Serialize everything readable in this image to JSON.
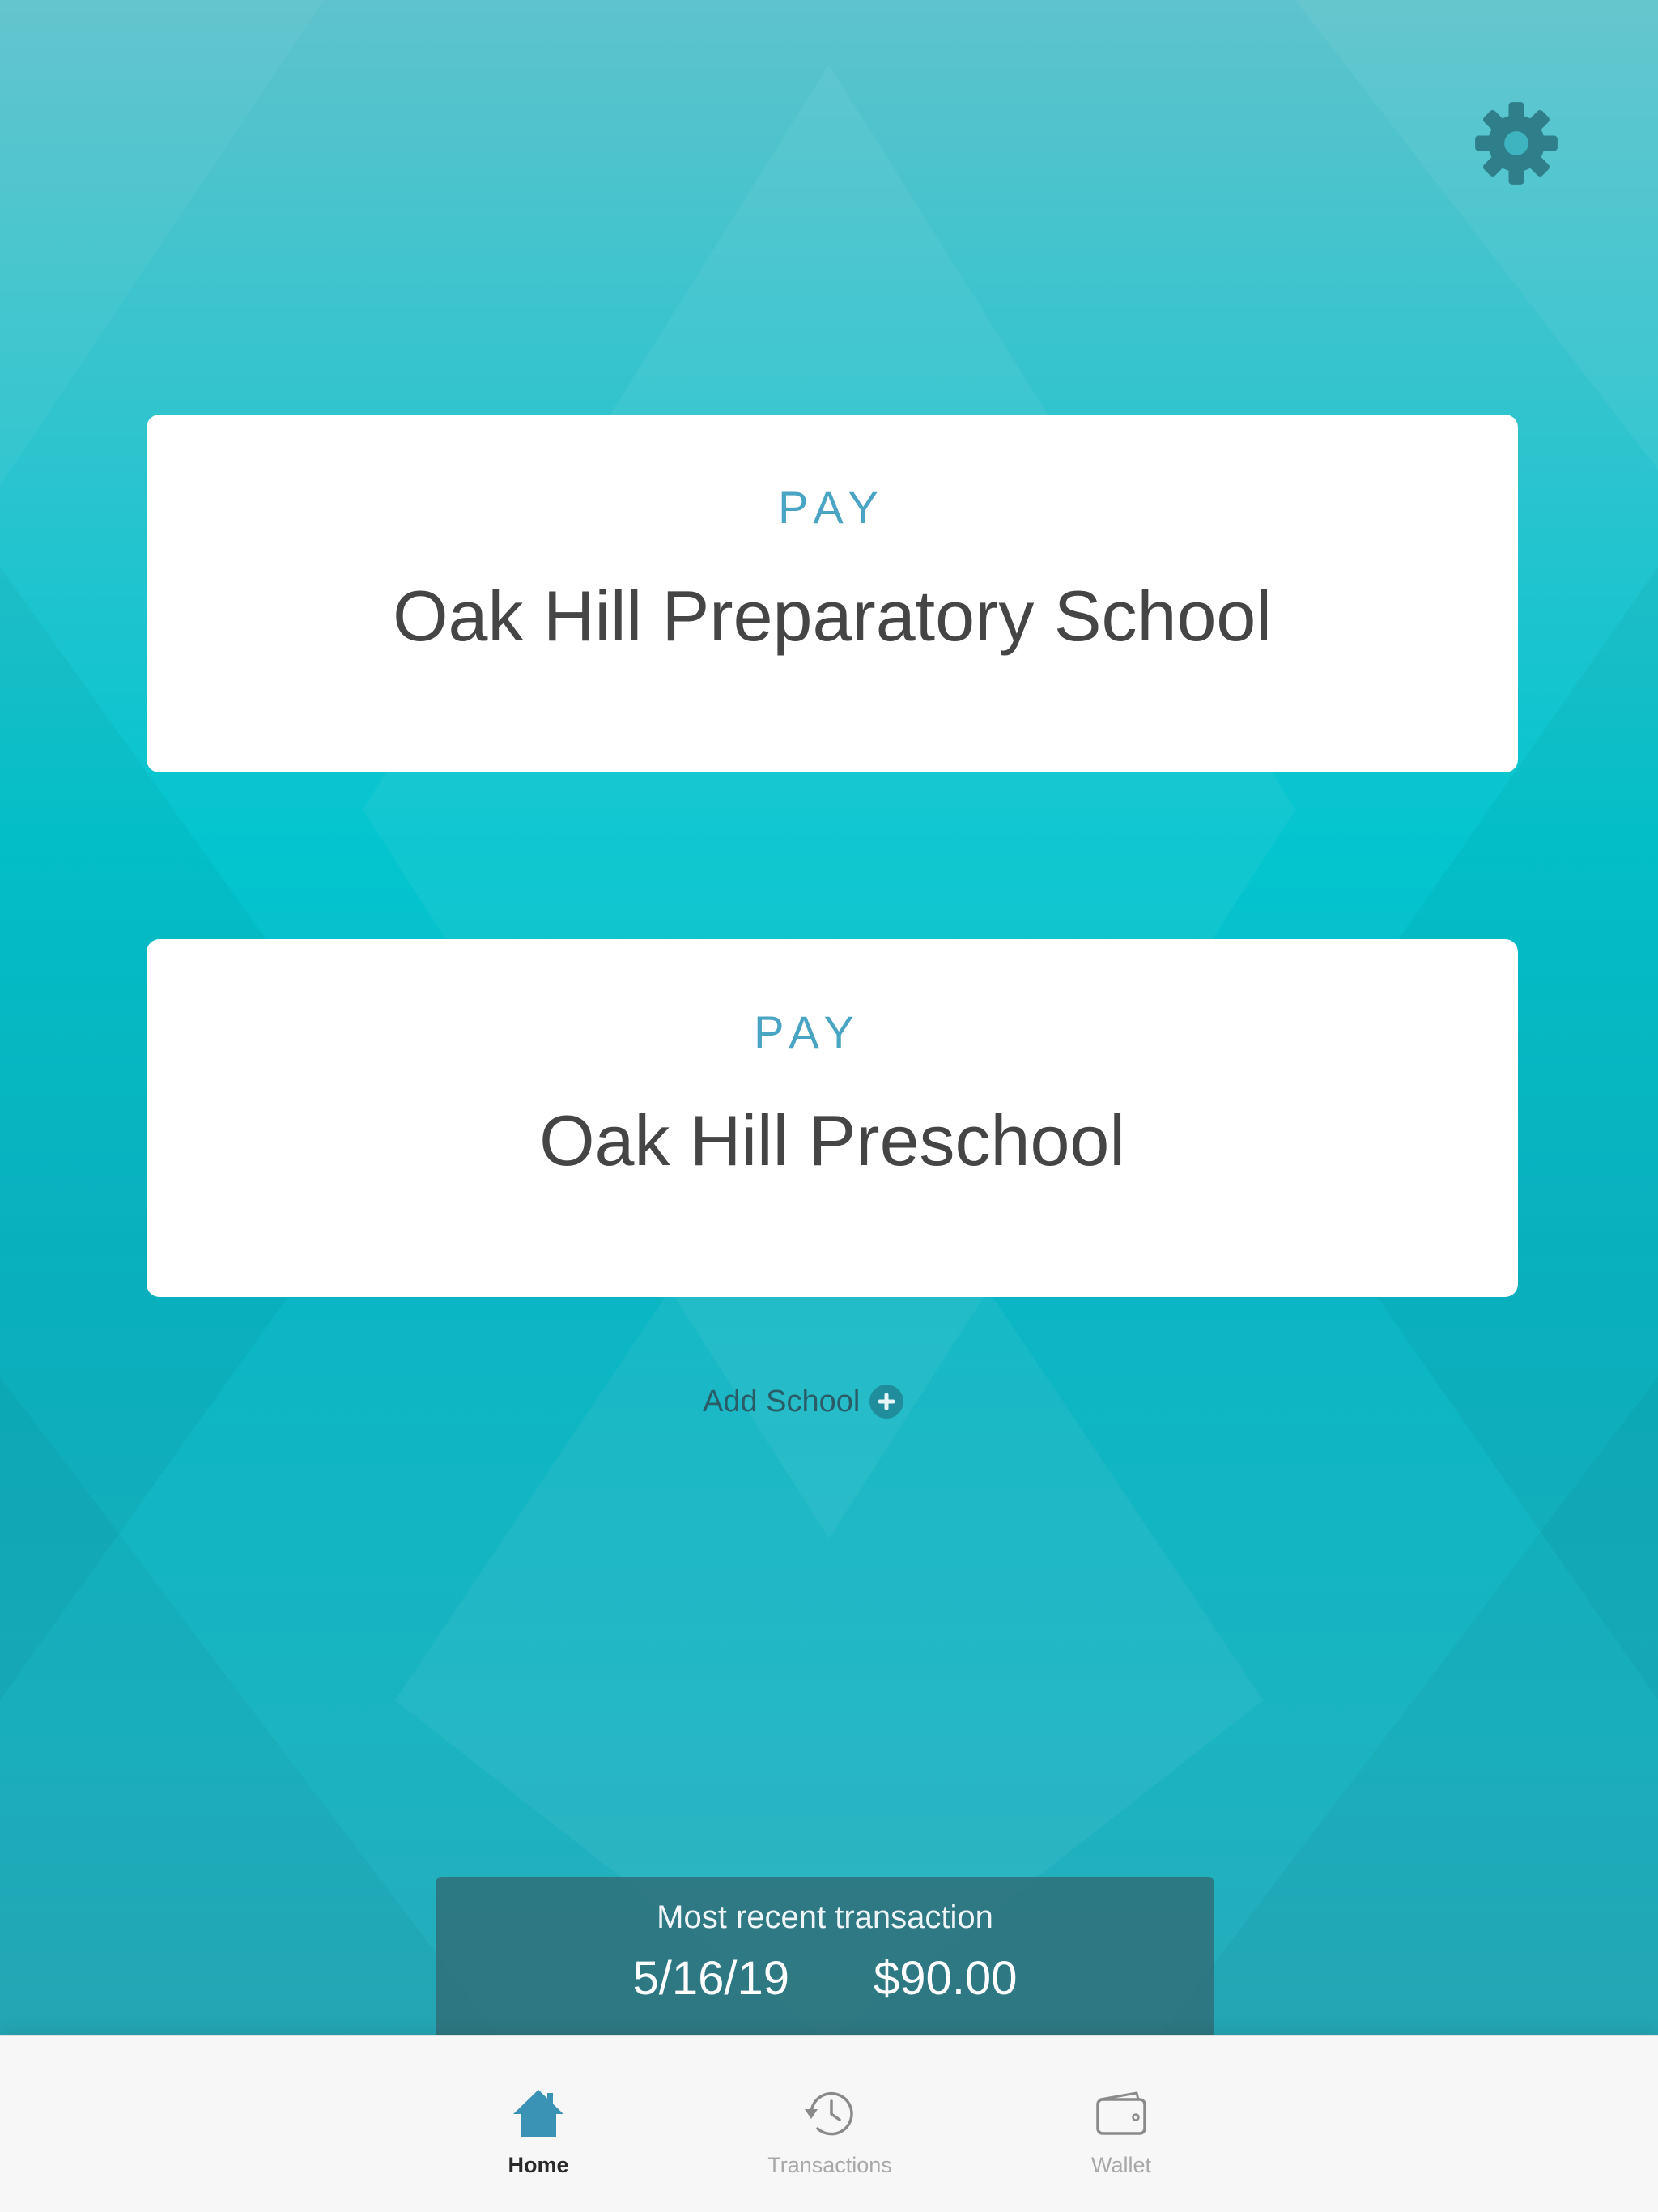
{
  "settings": {
    "icon": "gear-icon"
  },
  "schools": [
    {
      "action_label": "PAY",
      "name": "Oak Hill Preparatory School"
    },
    {
      "action_label": "PAY",
      "name": "Oak Hill Preschool"
    }
  ],
  "add_school": {
    "label": "Add School",
    "icon": "plus-circle-icon"
  },
  "recent_transaction": {
    "title": "Most recent transaction",
    "date": "5/16/19",
    "amount": "$90.00"
  },
  "tabbar": {
    "tabs": [
      {
        "label": "Home",
        "icon": "home-icon",
        "active": true
      },
      {
        "label": "Transactions",
        "icon": "history-icon",
        "active": false
      },
      {
        "label": "Wallet",
        "icon": "wallet-icon",
        "active": false
      }
    ]
  },
  "colors": {
    "accent": "#4aa5c4",
    "background_teal": "#04c5cf",
    "settings_icon": "#2f7f8a",
    "home_icon": "#3a92b5"
  }
}
